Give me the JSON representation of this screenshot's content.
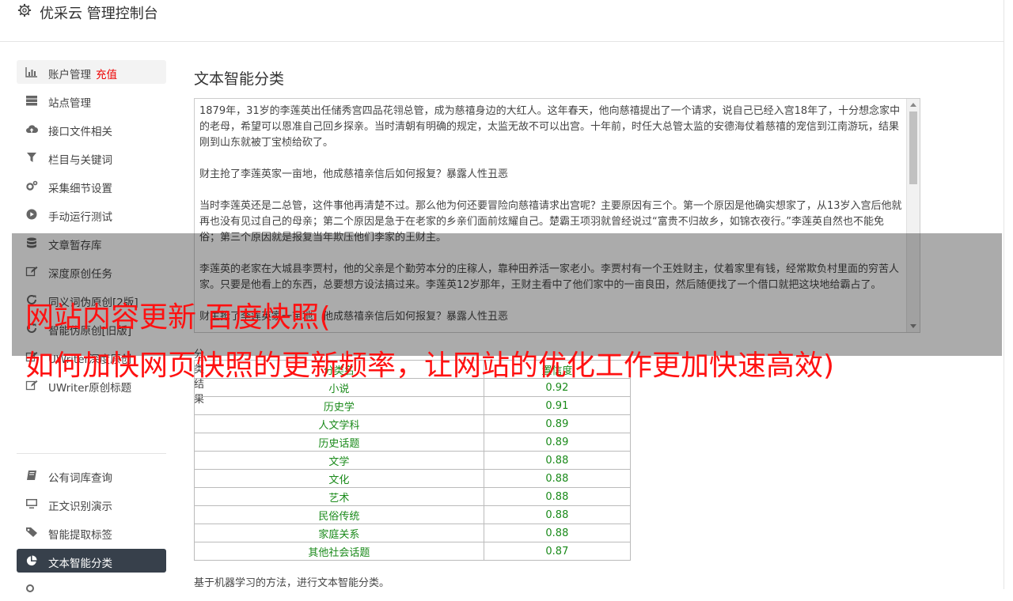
{
  "app": {
    "title": "优采云 管理控制台"
  },
  "sidebar": {
    "items": [
      {
        "label": "账户管理",
        "extra": "充值",
        "icon": "bar-chart-icon"
      },
      {
        "label": "站点管理",
        "icon": "server-icon"
      },
      {
        "label": "接口文件相关",
        "icon": "cloud-upload-icon"
      },
      {
        "label": "栏目与关键词",
        "icon": "filter-icon"
      },
      {
        "label": "采集细节设置",
        "icon": "gears-icon"
      },
      {
        "label": "手动运行测试",
        "icon": "play-circle-icon"
      },
      {
        "label": "文章暂存库",
        "icon": "database-icon"
      },
      {
        "label": "深度原创任务",
        "icon": "edit-icon"
      },
      {
        "label": "同义词伪原创[2版]",
        "icon": "refresh-icon"
      },
      {
        "label": "智能伪原创[旧版]",
        "icon": "refresh-icon"
      },
      {
        "label": "UWriter深度原创",
        "icon": "edit-icon"
      },
      {
        "label": "UWriter原创标题",
        "icon": "edit-icon"
      },
      {
        "label": "公有词库查询",
        "icon": "book-icon"
      },
      {
        "label": "正文识别演示",
        "icon": "monitor-icon"
      },
      {
        "label": "智能提取标签",
        "icon": "tag-icon"
      },
      {
        "label": "文本智能分类",
        "icon": "pie-chart-icon"
      }
    ]
  },
  "main": {
    "title": "文本智能分类",
    "paragraphs": [
      "1879年，31岁的李莲英出任储秀宫四品花翎总管，成为慈禧身边的大红人。这年春天，他向慈禧提出了一个请求，说自己已经入宫18年了，十分想念家中的老母，希望可以恩准自己回乡探亲。当时清朝有明确的规定，太监无故不可以出宫。十年前，时任大总管太监的安德海仗着慈禧的宠信到江南游玩，结果刚到山东就被丁宝桢给砍了。",
      "财主抢了李莲英家一亩地，他成慈禧亲信后如何报复？暴露人性丑恶",
      "当时李莲英还是二总管，这件事他再清楚不过。那么他为何还要冒险向慈禧请求出宫呢？主要原因有三个。第一个原因是他确实想家了，从13岁入宫后他就再也没有见过自己的母亲；第二个原因是急于在老家的乡亲们面前炫耀自己。楚霸王项羽就曾经说过“富贵不归故乡，如锦衣夜行。”李莲英自然也不能免俗；第三个原因就是报复当年欺压他们李家的王财主。",
      "李莲英的老家在大城县李贾村，他的父亲是个勤劳本分的庄稼人，靠种田养活一家老小。李贾村有一个王姓财主，仗着家里有钱，经常欺负村里面的穷苦人家。只要是他看上的东西，总要想方设法搞过来。李莲英12岁那年，王财主看中了他们家中的一亩良田，然后随便找了一个借口就把这块地给霸占了。",
      "财主抢了李莲英家一亩地，他成慈禧亲信后如何报复？暴露人性丑恶"
    ],
    "result_label": "分类结果",
    "table": {
      "headers": [
        "分类名",
        "置信度"
      ],
      "rows": [
        [
          "小说",
          "0.92"
        ],
        [
          "历史学",
          "0.91"
        ],
        [
          "人文学科",
          "0.89"
        ],
        [
          "历史话题",
          "0.89"
        ],
        [
          "文学",
          "0.88"
        ],
        [
          "文化",
          "0.88"
        ],
        [
          "艺术",
          "0.88"
        ],
        [
          "民俗传统",
          "0.88"
        ],
        [
          "家庭关系",
          "0.88"
        ],
        [
          "其他社会话题",
          "0.87"
        ]
      ]
    },
    "description": "基于机器学习的方法，进行文本智能分类。"
  },
  "overlay": {
    "line1": "网站内容更新 百度快照(",
    "line2": "如何加快网页快照的更新频率，让网站的优化工作更加快速高效)"
  },
  "colors": {
    "accent_red": "#ff1111",
    "active_nav": "#37404b",
    "result_green": "#1a8a1a"
  }
}
